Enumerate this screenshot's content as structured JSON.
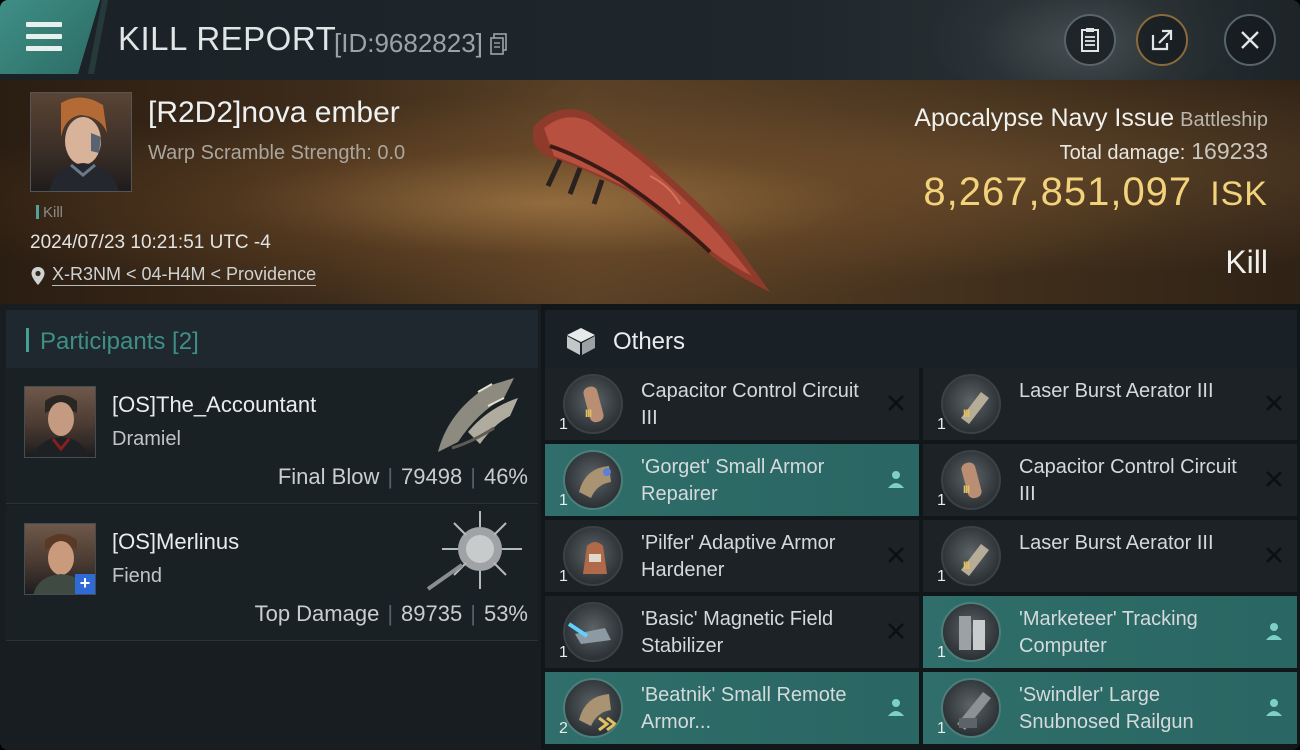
{
  "header": {
    "title": "KILL REPORT",
    "report_id": "[ID:9682823]",
    "icons": [
      "menu-icon",
      "copy-icon",
      "clipboard-icon",
      "share-icon",
      "close-icon"
    ]
  },
  "victim": {
    "name": "[R2D2]nova ember",
    "warp_scramble": "Warp Scramble Strength: 0.0",
    "kill_tag": "Kill",
    "datetime": "2024/07/23 10:21:51 UTC -4",
    "location": "X-R3NM < 04-H4M < Providence",
    "ship_name": "Apocalypse Navy Issue",
    "ship_class": "Battleship",
    "total_damage_label": "Total damage:",
    "total_damage": "169233",
    "isk_value": "8,267,851,097",
    "isk_unit": "ISK",
    "result": "Kill"
  },
  "participants": {
    "title": "Participants [2]",
    "rows": [
      {
        "name": "[OS]The_Accountant",
        "ship": "Dramiel",
        "role": "Final Blow",
        "damage": "79498",
        "percent": "46%"
      },
      {
        "name": "[OS]Merlinus",
        "ship": "Fiend",
        "role": "Top Damage",
        "damage": "89735",
        "percent": "53%"
      }
    ]
  },
  "others": {
    "title": "Others",
    "items": [
      {
        "name": "Capacitor Control Circuit III",
        "qty": "1",
        "status": "destroyed"
      },
      {
        "name": "Laser Burst Aerator III",
        "qty": "1",
        "status": "destroyed"
      },
      {
        "name": "'Gorget' Small Armor Repairer",
        "qty": "1",
        "status": "dropped"
      },
      {
        "name": "Capacitor Control Circuit III",
        "qty": "1",
        "status": "destroyed"
      },
      {
        "name": "'Pilfer' Adaptive Armor Hardener",
        "qty": "1",
        "status": "destroyed"
      },
      {
        "name": "Laser Burst Aerator III",
        "qty": "1",
        "status": "destroyed"
      },
      {
        "name": "'Basic' Magnetic Field Stabilizer",
        "qty": "1",
        "status": "destroyed"
      },
      {
        "name": "'Marketeer' Tracking Computer",
        "qty": "1",
        "status": "dropped"
      },
      {
        "name": "'Beatnik' Small Remote Armor...",
        "qty": "2",
        "status": "dropped"
      },
      {
        "name": "'Swindler' Large Snubnosed Railgun",
        "qty": "1",
        "status": "dropped"
      }
    ]
  },
  "colors": {
    "accent_teal": "#3f8f87",
    "isk_gold": "#f2d27a",
    "fitted_row": "#2f6e6a"
  }
}
